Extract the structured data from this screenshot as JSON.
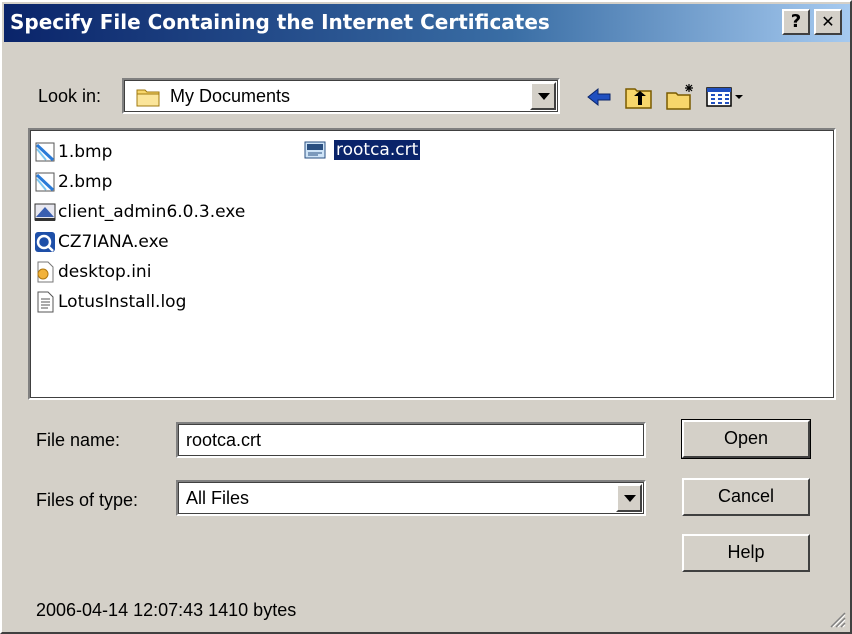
{
  "window": {
    "title": "Specify File Containing the Internet Certificates",
    "help_button": "?",
    "close_button": "✕"
  },
  "look_in": {
    "label": "Look in:",
    "value": "My Documents"
  },
  "toolbar": {
    "icons": [
      "back-icon",
      "up-one-level-icon",
      "create-new-folder-icon",
      "view-menu-icon"
    ]
  },
  "files": [
    {
      "name": "1.bmp",
      "icon": "bitmap-icon",
      "selected": false
    },
    {
      "name": "2.bmp",
      "icon": "bitmap-icon",
      "selected": false
    },
    {
      "name": "client_admin6.0.3.exe",
      "icon": "installer-icon",
      "selected": false
    },
    {
      "name": "CZ7IANA.exe",
      "icon": "application-icon",
      "selected": false
    },
    {
      "name": "desktop.ini",
      "icon": "settings-file-icon",
      "selected": false
    },
    {
      "name": "LotusInstall.log",
      "icon": "text-file-icon",
      "selected": false
    },
    {
      "name": "rootca.crt",
      "icon": "certificate-icon",
      "selected": true
    }
  ],
  "file_name": {
    "label": "File name:",
    "value": "rootca.crt"
  },
  "file_type": {
    "label": "Files of type:",
    "value": "All Files"
  },
  "buttons": {
    "open": "Open",
    "cancel": "Cancel",
    "help": "Help"
  },
  "status": "2006-04-14 12:07:43 1410 bytes"
}
